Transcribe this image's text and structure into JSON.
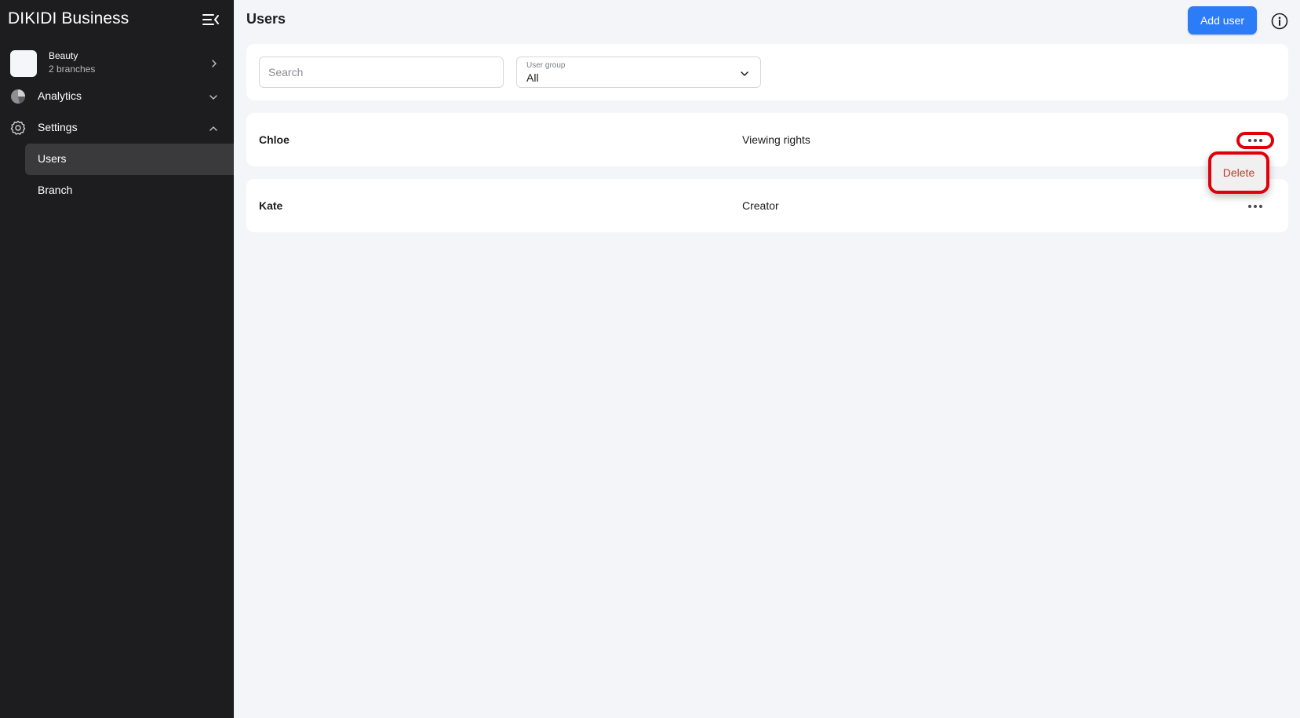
{
  "sidebar": {
    "brand": "DIKIDI Business",
    "branch": {
      "name": "Beauty",
      "subtitle": "2 branches"
    },
    "nav": [
      {
        "label": "Analytics",
        "expanded": false
      },
      {
        "label": "Settings",
        "expanded": true
      }
    ],
    "sub_items": [
      {
        "label": "Users",
        "active": true
      },
      {
        "label": "Branch",
        "active": false
      }
    ]
  },
  "header": {
    "title": "Users",
    "add_user_label": "Add user"
  },
  "filters": {
    "search_placeholder": "Search",
    "search_value": "",
    "user_group_caption": "User group",
    "user_group_value": "All"
  },
  "users": [
    {
      "name": "Chloe",
      "role": "Viewing rights"
    },
    {
      "name": "Kate",
      "role": "Creator"
    }
  ],
  "context_menu": {
    "delete_label": "Delete"
  },
  "colors": {
    "sidebar_bg": "#1d1d1f",
    "accent": "#2b7cf6",
    "highlight": "#e0000a",
    "page_bg": "#f3f5f9"
  }
}
